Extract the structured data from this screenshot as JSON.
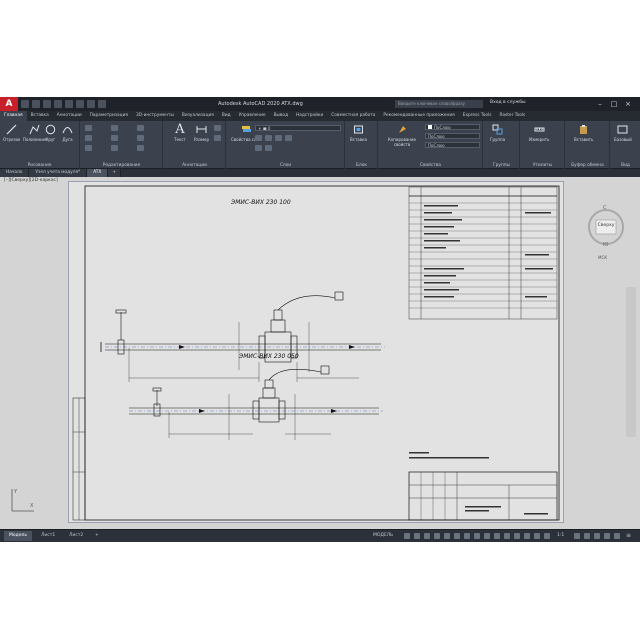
{
  "app": {
    "logo_text": "A",
    "title": "Autodesk AutoCAD 2020    ATX.dwg",
    "search_placeholder": "Введите ключевое слово/фразу",
    "signin": "Вход в службы",
    "accent": "#c8202a"
  },
  "ribbon_tabs": [
    "Главная",
    "Вставка",
    "Аннотации",
    "Параметризация",
    "3D-инструменты",
    "Визуализация",
    "Вид",
    "Управление",
    "Вывод",
    "Надстройки",
    "Совместная работа",
    "Рекомендованные приложения",
    "Express Tools",
    "Raster Tools"
  ],
  "panels": {
    "draw": {
      "label": "Рисование",
      "tools": [
        "Отрезок",
        "Полилиния",
        "Круг",
        "Дуга"
      ]
    },
    "modify": {
      "label": "Редактирование"
    },
    "annotation": {
      "label": "Аннотации",
      "tools": [
        "Текст",
        "Размер"
      ]
    },
    "layers": {
      "label": "Слои",
      "tool": "Свойства слоя"
    },
    "block": {
      "label": "Блок",
      "tool": "Вставка"
    },
    "properties": {
      "label": "Свойства",
      "tool": "Копирование свойств",
      "combo1": "ПоСлою",
      "combo2": "ПоСлою",
      "combo3": "ПоСлою"
    },
    "groups": {
      "label": "Группы",
      "tool": "Группа"
    },
    "utilities": {
      "label": "Утилиты",
      "tool": "Измерить"
    },
    "clipboard": {
      "label": "Буфер обмена",
      "tool": "Вставить"
    },
    "view": {
      "label": "Вид",
      "tool": "Базовый"
    }
  },
  "doc_tabs": [
    "Начало",
    "Узел учета модуля*",
    "ATX"
  ],
  "viewport_label": "[–][Сверху][2D-каркас]",
  "drawing": {
    "title_top": "ЭМИС-ВИХ 230 100",
    "title_bottom": "ЭМИС-ВИХ 230 050"
  },
  "viewcube": {
    "face": "Сверху",
    "compass_n": "С",
    "compass_s": "Ю",
    "wcs": "МСК"
  },
  "status_tabs": [
    "Модель",
    "Лист1",
    "Лист2"
  ],
  "status_model": "МОДЕЛЬ",
  "status_scale": "1:1"
}
